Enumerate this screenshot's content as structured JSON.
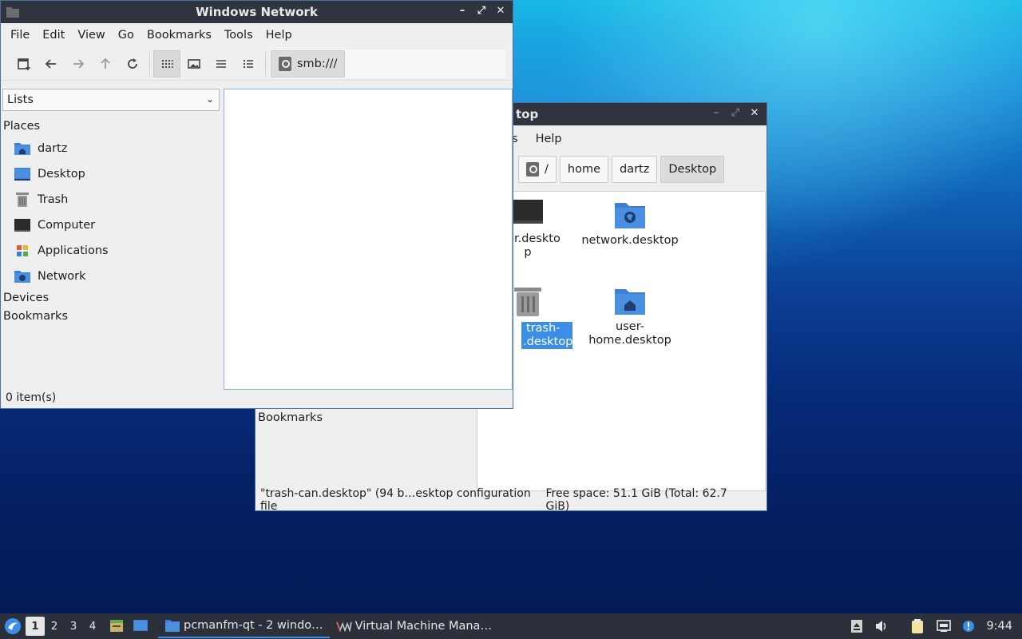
{
  "front_window": {
    "title": "Windows Network",
    "menu": [
      "File",
      "Edit",
      "View",
      "Go",
      "Bookmarks",
      "Tools",
      "Help"
    ],
    "location": "smb:///",
    "sidebar_mode": "Lists",
    "places_heading": "Places",
    "places": [
      {
        "label": "dartz",
        "icon": "home-folder-icon"
      },
      {
        "label": "Desktop",
        "icon": "desktop-icon"
      },
      {
        "label": "Trash",
        "icon": "trash-icon"
      },
      {
        "label": "Computer",
        "icon": "computer-icon"
      },
      {
        "label": "Applications",
        "icon": "applications-icon"
      },
      {
        "label": "Network",
        "icon": "network-icon"
      }
    ],
    "devices_heading": "Devices",
    "bookmarks_heading": "Bookmarks",
    "status": "0 item(s)"
  },
  "back_window": {
    "title_visible": "top",
    "menu_visible": [
      "s",
      "Help"
    ],
    "breadcrumbs": [
      "/",
      "home",
      "dartz",
      "Desktop"
    ],
    "bookmarks_heading": "Bookmarks",
    "files": [
      {
        "label1": "uter.deskto",
        "label2": "p"
      },
      {
        "label1": "network.desktop",
        "label2": ""
      },
      {
        "label1": "trash-",
        "label2": ".desktop"
      },
      {
        "label1": "user-",
        "label2": "home.desktop"
      }
    ],
    "status_left": "\"trash-can.desktop\" (94 b…esktop configuration file",
    "status_right": "Free space: 51.1 GiB (Total: 62.7 GiB)"
  },
  "taskbar": {
    "workspaces": [
      "1",
      "2",
      "3",
      "4"
    ],
    "tasks": [
      {
        "label": "pcmanfm-qt - 2 windo…",
        "icon": "folder-icon"
      },
      {
        "label": "Virtual Machine Mana…",
        "icon": "virt-manager-icon"
      }
    ],
    "clock": "9:44"
  },
  "colors": {
    "accent": "#3a8ee6",
    "titlebar": "#2f343f",
    "taskbar": "#2b303b",
    "folder": "#3f7fd1"
  }
}
